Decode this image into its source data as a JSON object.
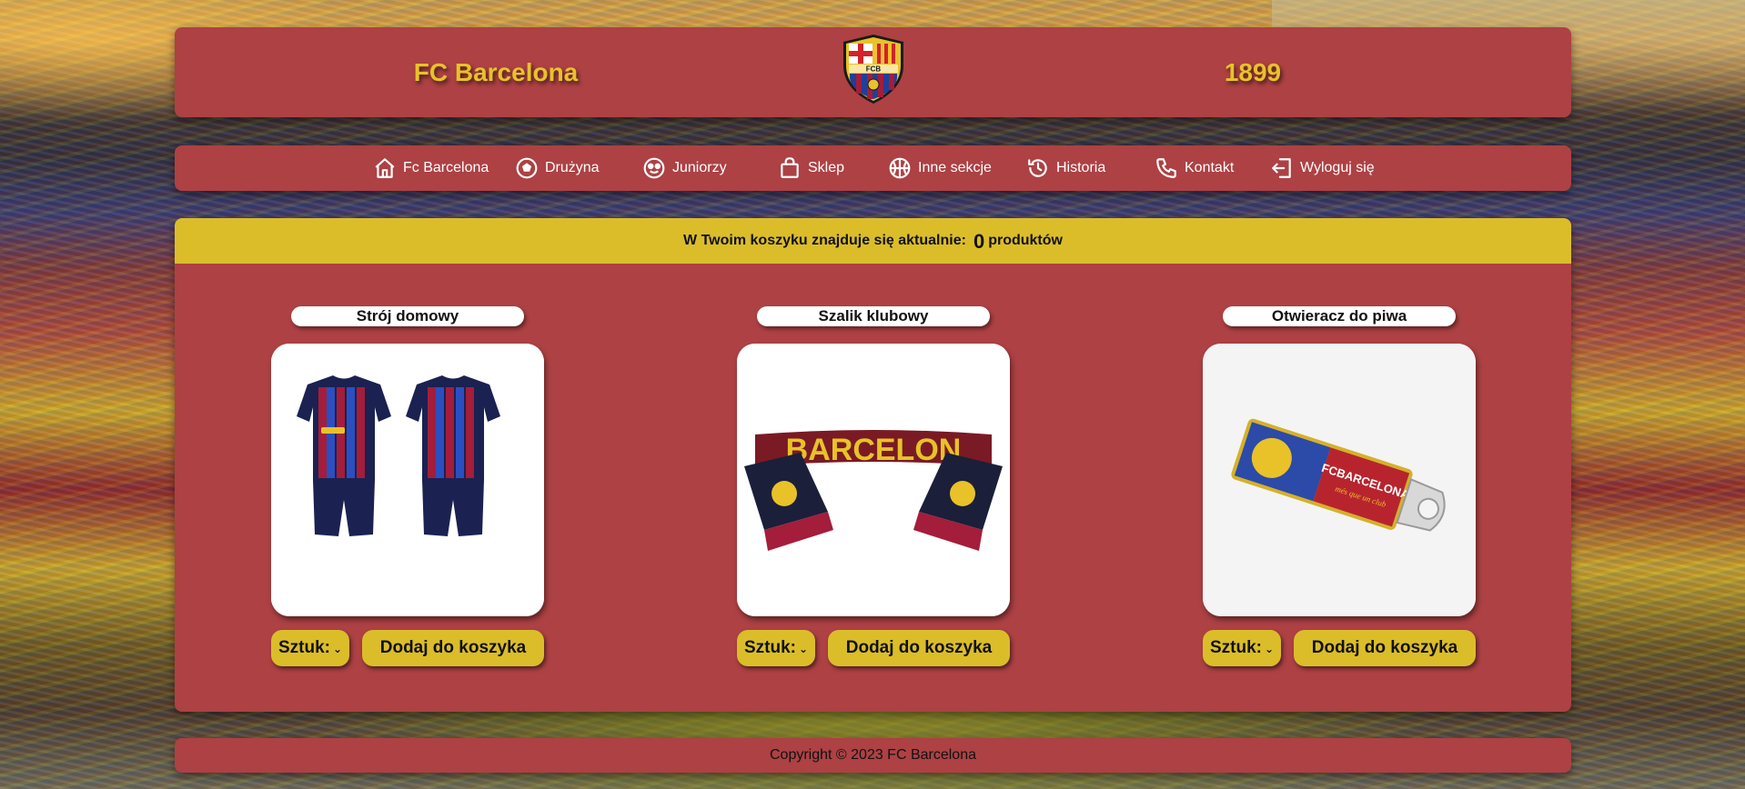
{
  "header": {
    "title": "FC Barcelona",
    "year": "1899",
    "crest_letters": "FCB"
  },
  "nav": {
    "items": [
      {
        "label": "Fc Barcelona",
        "icon": "home-icon"
      },
      {
        "label": "Drużyna",
        "icon": "soccer-ball-icon"
      },
      {
        "label": "Juniorzy",
        "icon": "face-icon"
      },
      {
        "label": "Sklep",
        "icon": "shopping-bag-icon"
      },
      {
        "label": "Inne sekcje",
        "icon": "basketball-icon"
      },
      {
        "label": "Historia",
        "icon": "history-clock-icon"
      },
      {
        "label": "Kontakt",
        "icon": "phone-icon"
      },
      {
        "label": "Wyloguj się",
        "icon": "logout-icon"
      }
    ]
  },
  "cart": {
    "text_before": "W Twoim koszyku znajduje się aktualnie:",
    "count": "0",
    "text_after": "produktów"
  },
  "products": [
    {
      "name": "Strój domowy",
      "qty_label": "Sztuk:",
      "button": "Dodaj do koszyka"
    },
    {
      "name": "Szalik klubowy",
      "qty_label": "Sztuk:",
      "button": "Dodaj do koszyka",
      "image_text": "BARCELON"
    },
    {
      "name": "Otwieracz do piwa",
      "qty_label": "Sztuk:",
      "button": "Dodaj do koszyka",
      "image_text": "FCBARCELONA",
      "image_text_2": "més que un club"
    }
  ],
  "footer": {
    "copyright": "Copyright © 2023 FC Barcelona"
  },
  "colors": {
    "panel": "#ad4144",
    "gold": "#dbbd2a",
    "title_gold": "#e8c228",
    "blaugrana_blue": "#1f3f9a",
    "blaugrana_red": "#a41d3a"
  }
}
